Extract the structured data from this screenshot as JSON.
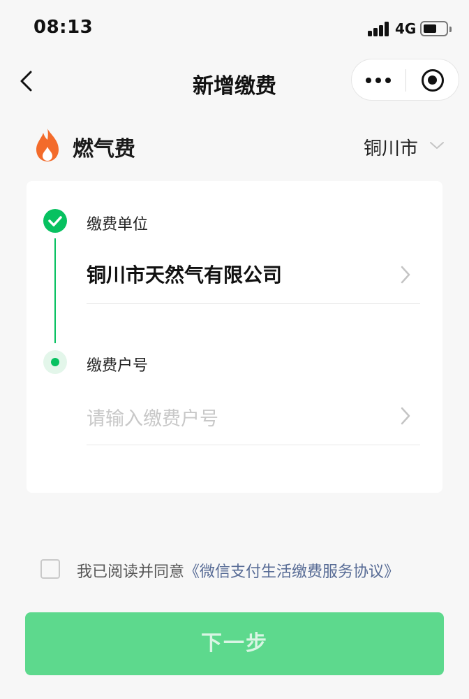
{
  "status_bar": {
    "time": "08:13",
    "network": "4G",
    "battery_level": 0.5
  },
  "nav": {
    "title": "新增缴费",
    "more_icon": "more-dots-icon",
    "close_icon": "target-icon"
  },
  "category": {
    "icon": "flame-icon",
    "name": "燃气费",
    "city": "铜川市",
    "accent_color": "#f36b2b"
  },
  "form": {
    "step1": {
      "label": "缴费单位",
      "value": "铜川市天然气有限公司",
      "status": "done"
    },
    "step2": {
      "label": "缴费户号",
      "placeholder": "请输入缴费户号",
      "status": "current"
    }
  },
  "agreement": {
    "text": "我已阅读并同意",
    "link": "《微信支付生活缴费服务协议》",
    "checked": false
  },
  "next_button": {
    "label": "下一步",
    "color": "#5dd98d"
  },
  "colors": {
    "brand_green": "#07c160",
    "link_blue": "#576b95"
  }
}
